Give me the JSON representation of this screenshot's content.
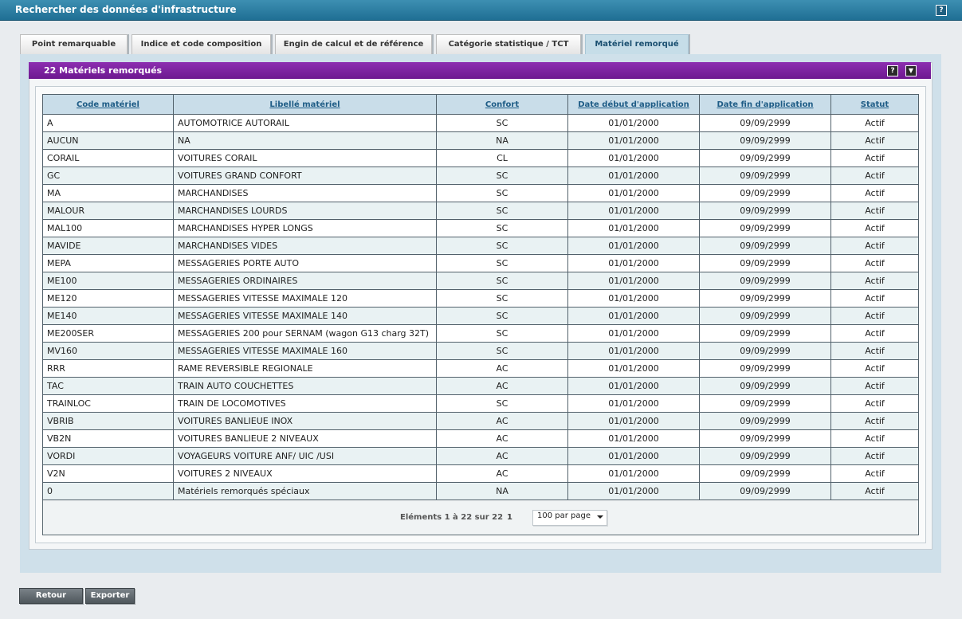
{
  "window": {
    "title": "Rechercher des données d'infrastructure",
    "help": "?"
  },
  "tabs": [
    {
      "label": "Point remarquable"
    },
    {
      "label": "Indice et code composition"
    },
    {
      "label": "Engin de calcul et de référence"
    },
    {
      "label": "Catégorie statistique / TCT"
    },
    {
      "label": "Matériel remorqué",
      "active": true
    }
  ],
  "panel": {
    "title": "22 Matériels remorqués",
    "help": "?",
    "menu": "▼"
  },
  "table": {
    "columns": [
      "Code matériel",
      "Libellé matériel",
      "Confort",
      "Date début d'application",
      "Date fin d'application",
      "Statut"
    ],
    "rows": [
      [
        "A",
        "AUTOMOTRICE AUTORAIL",
        "SC",
        "01/01/2000",
        "09/09/2999",
        "Actif"
      ],
      [
        "AUCUN",
        "NA",
        "NA",
        "01/01/2000",
        "09/09/2999",
        "Actif"
      ],
      [
        "CORAIL",
        "VOITURES CORAIL",
        "CL",
        "01/01/2000",
        "09/09/2999",
        "Actif"
      ],
      [
        "GC",
        "VOITURES GRAND CONFORT",
        "SC",
        "01/01/2000",
        "09/09/2999",
        "Actif"
      ],
      [
        "MA",
        "MARCHANDISES",
        "SC",
        "01/01/2000",
        "09/09/2999",
        "Actif"
      ],
      [
        "MALOUR",
        "MARCHANDISES LOURDS",
        "SC",
        "01/01/2000",
        "09/09/2999",
        "Actif"
      ],
      [
        "MAL100",
        "MARCHANDISES HYPER LONGS",
        "SC",
        "01/01/2000",
        "09/09/2999",
        "Actif"
      ],
      [
        "MAVIDE",
        "MARCHANDISES VIDES",
        "SC",
        "01/01/2000",
        "09/09/2999",
        "Actif"
      ],
      [
        "MEPA",
        "MESSAGERIES PORTE AUTO",
        "SC",
        "01/01/2000",
        "09/09/2999",
        "Actif"
      ],
      [
        "ME100",
        "MESSAGERIES ORDINAIRES",
        "SC",
        "01/01/2000",
        "09/09/2999",
        "Actif"
      ],
      [
        "ME120",
        "MESSAGERIES VITESSE MAXIMALE 120",
        "SC",
        "01/01/2000",
        "09/09/2999",
        "Actif"
      ],
      [
        "ME140",
        "MESSAGERIES VITESSE MAXIMALE 140",
        "SC",
        "01/01/2000",
        "09/09/2999",
        "Actif"
      ],
      [
        "ME200SER",
        "MESSAGERIES 200 pour SERNAM (wagon G13 charg 32T)",
        "SC",
        "01/01/2000",
        "09/09/2999",
        "Actif"
      ],
      [
        "MV160",
        "MESSAGERIES VITESSE MAXIMALE 160",
        "SC",
        "01/01/2000",
        "09/09/2999",
        "Actif"
      ],
      [
        "RRR",
        "RAME REVERSIBLE REGIONALE",
        "AC",
        "01/01/2000",
        "09/09/2999",
        "Actif"
      ],
      [
        "TAC",
        "TRAIN AUTO COUCHETTES",
        "AC",
        "01/01/2000",
        "09/09/2999",
        "Actif"
      ],
      [
        "TRAINLOC",
        "TRAIN DE LOCOMOTIVES",
        "SC",
        "01/01/2000",
        "09/09/2999",
        "Actif"
      ],
      [
        "VBRIB",
        "VOITURES BANLIEUE INOX",
        "AC",
        "01/01/2000",
        "09/09/2999",
        "Actif"
      ],
      [
        "VB2N",
        "VOITURES BANLIEUE 2 NIVEAUX",
        "AC",
        "01/01/2000",
        "09/09/2999",
        "Actif"
      ],
      [
        "VORDI",
        "VOYAGEURS VOITURE ANF/ UIC /USI",
        "AC",
        "01/01/2000",
        "09/09/2999",
        "Actif"
      ],
      [
        "V2N",
        "VOITURES 2 NIVEAUX",
        "AC",
        "01/01/2000",
        "09/09/2999",
        "Actif"
      ],
      [
        "0",
        "Matériels remorqués spéciaux",
        "NA",
        "01/01/2000",
        "09/09/2999",
        "Actif"
      ]
    ]
  },
  "pager": {
    "info": "Eléments 1 à 22 sur 22",
    "page": "1",
    "per_page": "100 par page"
  },
  "buttons": {
    "back": "Retour",
    "export": "Exporter"
  }
}
